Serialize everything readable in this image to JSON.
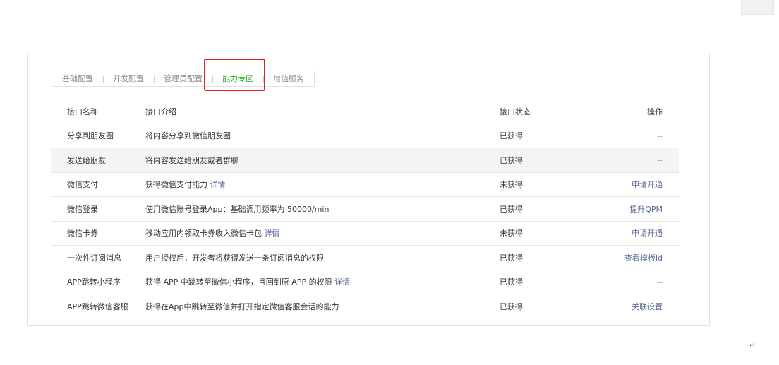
{
  "tabs": [
    {
      "label": "基础配置"
    },
    {
      "label": "开发配置"
    },
    {
      "label": "管理员配置"
    },
    {
      "label": "能力专区"
    },
    {
      "label": "增值服务"
    }
  ],
  "active_tab": "能力专区",
  "table": {
    "headers": {
      "name": "接口名称",
      "desc": "接口介绍",
      "status": "接口状态",
      "op": "操作"
    },
    "rows": [
      {
        "name": "分享到朋友圈",
        "desc": "将内容分享到微信朋友圈",
        "desc_link": "",
        "status": "已获得",
        "op": "--"
      },
      {
        "name": "发送给朋友",
        "desc": "将内容发送给朋友或者群聊",
        "desc_link": "",
        "status": "已获得",
        "op": "--"
      },
      {
        "name": "微信支付",
        "desc": "获得微信支付能力",
        "desc_link": "详情",
        "status": "未获得",
        "op": "申请开通"
      },
      {
        "name": "微信登录",
        "desc": "使用微信账号登录App：基础调用频率为 50000/min",
        "desc_link": "",
        "status": "已获得",
        "op": "提升QPM"
      },
      {
        "name": "微信卡券",
        "desc": "移动应用内领取卡券收入微信卡包",
        "desc_link": "详情",
        "status": "未获得",
        "op": "申请开通"
      },
      {
        "name": "一次性订阅消息",
        "desc": "用户授权后，开发者将获得发送一条订阅消息的权限",
        "desc_link": "",
        "status": "已获得",
        "op": "查看模板id"
      },
      {
        "name": "APP跳转小程序",
        "desc": "获得 APP 中跳转至微信小程序，且回到原 APP 的权限",
        "desc_link": "详情",
        "status": "已获得",
        "op": "--"
      },
      {
        "name": "APP跳转微信客服",
        "desc": "获得在App中跳转至微信并打开指定微信客服会话的能力",
        "desc_link": "",
        "status": "已获得",
        "op": "关联设置"
      }
    ]
  },
  "colors": {
    "accent_green": "#1aad19",
    "link_blue": "#576b95",
    "highlight_red": "#e0232a"
  },
  "page_marks": {
    "corner_dot": ".",
    "return_mark": "↵"
  }
}
